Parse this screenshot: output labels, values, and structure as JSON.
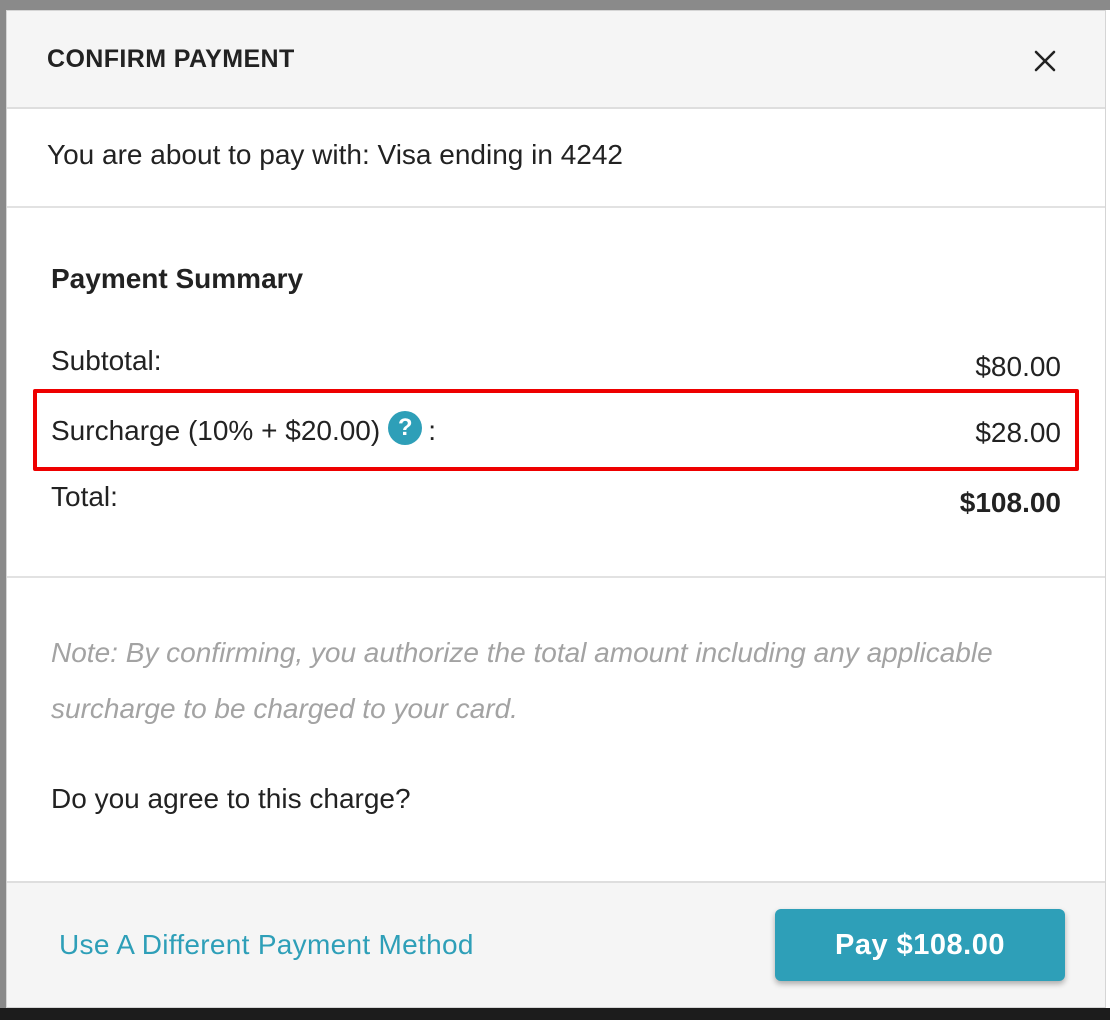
{
  "modal": {
    "title": "CONFIRM PAYMENT",
    "close_icon": "close-icon",
    "pay_with_text": "You are about to pay with: Visa ending in 4242"
  },
  "summary": {
    "title": "Payment Summary",
    "subtotal_label": "Subtotal:",
    "subtotal_value": "$80.00",
    "surcharge_label": "Surcharge (10% + $20.00)",
    "surcharge_colon": ":",
    "surcharge_help_glyph": "?",
    "surcharge_value": "$28.00",
    "total_label": "Total:",
    "total_value": "$108.00"
  },
  "note": "Note: By confirming, you authorize the total amount including any applicable surcharge to be charged to your card.",
  "agree_question": "Do you agree to this charge?",
  "footer": {
    "alt_method_link": "Use A Different Payment Method",
    "pay_button": "Pay $108.00"
  },
  "colors": {
    "accent": "#2e9fb8",
    "highlight": "#ee0000",
    "note_text": "#a3a3a3"
  }
}
